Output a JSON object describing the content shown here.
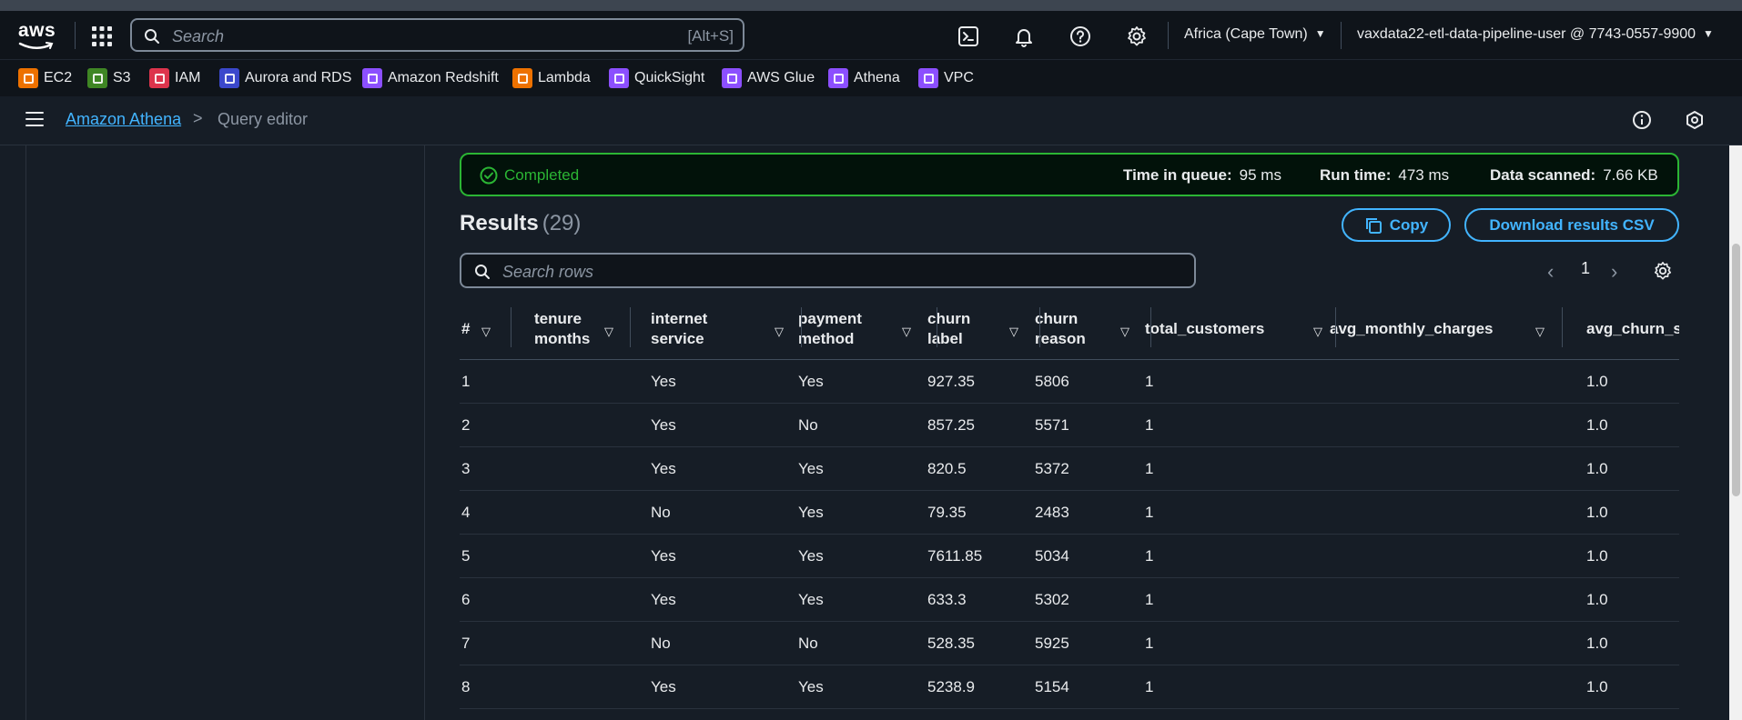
{
  "header": {
    "logo_text": "aws",
    "search_placeholder": "Search",
    "search_shortcut": "[Alt+S]",
    "region": "Africa (Cape Town)",
    "account": "vaxdata22-etl-data-pipeline-user @ 7743-0557-9900"
  },
  "favorites": [
    {
      "label": "EC2",
      "color": "#ed7100"
    },
    {
      "label": "S3",
      "color": "#3f8624"
    },
    {
      "label": "IAM",
      "color": "#dd344c"
    },
    {
      "label": "Aurora and RDS",
      "color": "#3b48cc"
    },
    {
      "label": "Amazon Redshift",
      "color": "#8c4fff"
    },
    {
      "label": "Lambda",
      "color": "#ed7100"
    },
    {
      "label": "QuickSight",
      "color": "#8c4fff"
    },
    {
      "label": "AWS Glue",
      "color": "#8c4fff"
    },
    {
      "label": "Athena",
      "color": "#8c4fff"
    },
    {
      "label": "VPC",
      "color": "#8c4fff"
    }
  ],
  "breadcrumb": {
    "parent": "Amazon Athena",
    "separator": ">",
    "current": "Query editor"
  },
  "status": {
    "label": "Completed",
    "queue_label": "Time in queue:",
    "queue_value": "95 ms",
    "run_label": "Run time:",
    "run_value": "473 ms",
    "scanned_label": "Data scanned:",
    "scanned_value": "7.66 KB",
    "color": "#2bb534"
  },
  "results": {
    "title": "Results",
    "count": "(29)",
    "copy_label": "Copy",
    "download_label": "Download results CSV",
    "search_placeholder": "Search rows",
    "page": "1"
  },
  "table": {
    "columns": [
      {
        "l1": "#",
        "l2": ""
      },
      {
        "l1": "tenure",
        "l2": "months"
      },
      {
        "l1": "internet",
        "l2": "service"
      },
      {
        "l1": "payment",
        "l2": "method"
      },
      {
        "l1": "churn",
        "l2": "label"
      },
      {
        "l1": "churn",
        "l2": "reason"
      },
      {
        "l1": "total_customers",
        "l2": ""
      },
      {
        "l1": "avg_monthly_charges",
        "l2": ""
      },
      {
        "l1": "avg_churn_s",
        "l2": ""
      }
    ],
    "rows": [
      [
        "1",
        "",
        "Yes",
        "Yes",
        "927.35",
        "5806",
        "1",
        "",
        "1.0"
      ],
      [
        "2",
        "",
        "Yes",
        "No",
        "857.25",
        "5571",
        "1",
        "",
        "1.0"
      ],
      [
        "3",
        "",
        "Yes",
        "Yes",
        "820.5",
        "5372",
        "1",
        "",
        "1.0"
      ],
      [
        "4",
        "",
        "No",
        "Yes",
        "79.35",
        "2483",
        "1",
        "",
        "1.0"
      ],
      [
        "5",
        "",
        "Yes",
        "Yes",
        "7611.85",
        "5034",
        "1",
        "",
        "1.0"
      ],
      [
        "6",
        "",
        "Yes",
        "Yes",
        "633.3",
        "5302",
        "1",
        "",
        "1.0"
      ],
      [
        "7",
        "",
        "No",
        "No",
        "528.35",
        "5925",
        "1",
        "",
        "1.0"
      ],
      [
        "8",
        "",
        "Yes",
        "Yes",
        "5238.9",
        "5154",
        "1",
        "",
        "1.0"
      ]
    ]
  },
  "colors": {
    "link": "#42b4ff",
    "background": "#161d26",
    "header": "#0f141a"
  }
}
